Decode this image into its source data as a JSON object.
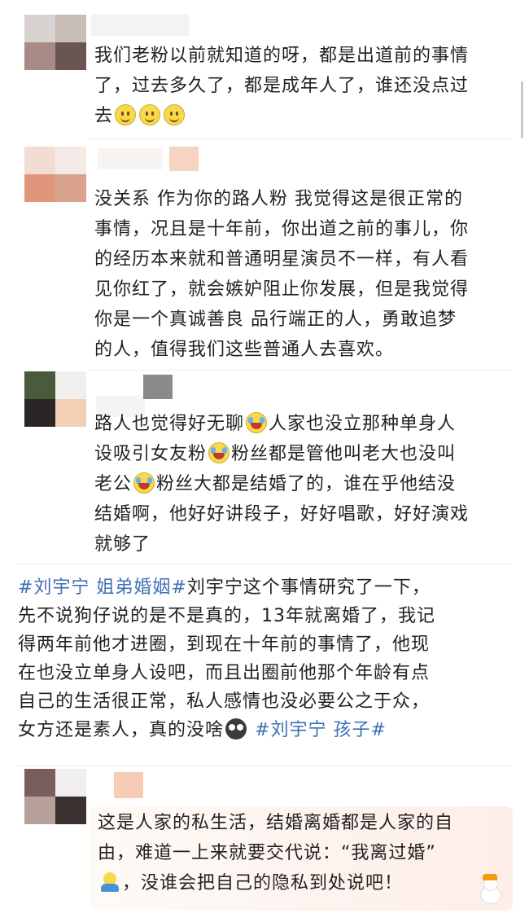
{
  "comments": [
    {
      "lines": [
        "我们老粉以前就知道的呀，都是出道前的事情",
        "了，过去多久了，都是成年人了，谁还没点过",
        "去"
      ],
      "emoji": [
        "smile-icon",
        "smile-icon",
        "smile-icon"
      ]
    },
    {
      "lines": [
        "没关系 作为你的路人粉 我觉得这是很正常的",
        "事情，况且是十年前，你出道之前的事儿，你",
        "的经历本来就和普通明星演员不一样，有人看",
        "见你红了，就会嫉妒阻止你发展，但是我觉得",
        "你是一个真诚善良 品行端正的人，勇敢追梦",
        "的人，值得我们这些普通人去喜欢。"
      ]
    },
    {
      "segments": [
        "路人也觉得好无聊",
        "人家也没立那种单身人",
        "设吸引女友粉",
        "粉丝都是管他叫老大也没叫",
        "老公",
        "粉丝大都是结婚了的，谁在乎他结没",
        "结婚啊，他好好讲段子，好好唱歌，好好演戏",
        "就够了"
      ],
      "emoji": [
        "laugh-cry-icon",
        "laugh-cry-icon",
        "laugh-cry-icon"
      ]
    },
    {
      "hashtag_1": "#刘宇宁 姐弟婚姻#",
      "segments": [
        "刘宇宁这个事情研究了一下，",
        "先不说狗仔说的是不是真的，13年就离婚了，我记",
        "得两年前他才进圈，到现在十年前的事情了，他现",
        "在也没立单身人设吧，而且出圈前他那个年龄有点",
        "自己的生活很正常，私人感情也没必要公之于众，",
        "女方还是素人，真的没啥"
      ],
      "hashtag_2": "#刘宇宁 孩子#",
      "emoji": [
        "shocked-face-icon"
      ]
    },
    {
      "segments": [
        "这是人家的私生活，结婚离婚都是人家的自",
        "由，难道一上来就要交代说：“我离过婚”",
        "，没谁会把自己的隐私到处说吧！"
      ],
      "emoji": [
        "shrug-icon",
        "snowman-icon"
      ]
    }
  ],
  "colors": {
    "text": "#222222",
    "hashtag": "#3f6fb5",
    "bubble_bg": "#fdeee8"
  }
}
